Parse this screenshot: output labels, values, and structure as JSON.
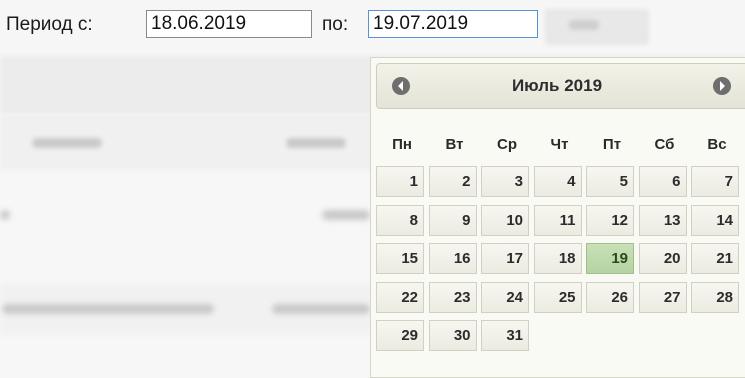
{
  "filter": {
    "period_from_label": "Период с:",
    "from_value": "18.06.2019",
    "to_label": "по:",
    "to_value": "19.07.2019"
  },
  "datepicker": {
    "title": "Июль 2019",
    "prev_icon": "chevron-left-icon",
    "next_icon": "chevron-right-icon",
    "weekdays": [
      "Пн",
      "Вт",
      "Ср",
      "Чт",
      "Пт",
      "Сб",
      "Вс"
    ],
    "weeks": [
      [
        "1",
        "2",
        "3",
        "4",
        "5",
        "6",
        "7"
      ],
      [
        "8",
        "9",
        "10",
        "11",
        "12",
        "13",
        "14"
      ],
      [
        "15",
        "16",
        "17",
        "18",
        "19",
        "20",
        "21"
      ],
      [
        "22",
        "23",
        "24",
        "25",
        "26",
        "27",
        "28"
      ],
      [
        "29",
        "30",
        "31"
      ]
    ],
    "selected_day": "19",
    "colors": {
      "selected_day_bg": "#b9d6a6",
      "day_bg": "#f2f2ea",
      "nav_icon": "#6e6e6e"
    }
  }
}
